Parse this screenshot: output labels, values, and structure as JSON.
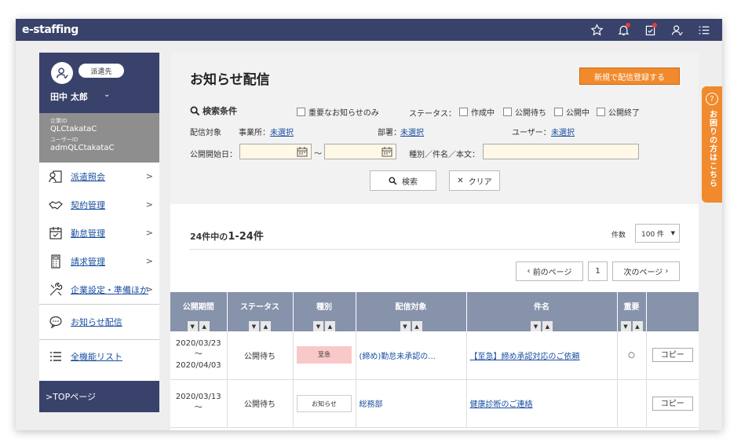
{
  "app": {
    "logo": "e-staffing"
  },
  "topbar": {
    "icons": [
      "star-icon",
      "bell-icon",
      "task-icon",
      "user-switch-icon",
      "menu-icon"
    ]
  },
  "user": {
    "tag": "派遣先",
    "name": "田中 太郎",
    "company_id_label": "企業ID",
    "company_id": "QLCtakataC",
    "user_id_label": "ユーザーID",
    "user_id": "admQLCtakataC"
  },
  "sidebar": {
    "items": [
      {
        "label": "派遣照会",
        "icon": "person-card-icon"
      },
      {
        "label": "契約管理",
        "icon": "handshake-icon"
      },
      {
        "label": "勤怠管理",
        "icon": "calendar-check-icon"
      },
      {
        "label": "請求管理",
        "icon": "calculator-icon"
      },
      {
        "label": "企業設定・準備ほか",
        "icon": "tools-icon"
      }
    ],
    "notice": "お知らせ配信",
    "all_functions": "全機能リスト",
    "top_page": ">TOPページ"
  },
  "main": {
    "title": "お知らせ配信",
    "new_button": "新規で配信登録する",
    "search": {
      "title": "検索条件",
      "important_only": "重要なお知らせのみ",
      "status_label": "ステータス：",
      "status_options": [
        "作成中",
        "公開待ち",
        "公開中",
        "公開終了"
      ],
      "target_label": "配信対象",
      "office_label": "事業所：",
      "office_value": "未選択",
      "dept_label": "部署：",
      "dept_value": "未選択",
      "user_label": "ユーザー：",
      "user_value": "未選択",
      "date_label": "公開開始日：",
      "tilde": "～",
      "keyword_label": "種別／件名／本文：",
      "search_button": "検索",
      "clear_button": "クリア"
    },
    "results": {
      "count_prefix": "24件中の",
      "count_range": "1-24件",
      "per_page_label": "件数",
      "per_page_value": "100 件",
      "prev": "前のページ",
      "page": "1",
      "next": "次のページ"
    },
    "table": {
      "headers": [
        "公開期間",
        "ステータス",
        "種別",
        "配信対象",
        "件名",
        "重要",
        ""
      ],
      "rows": [
        {
          "start": "2020/03/23",
          "tilde": "～",
          "end": "2020/04/03",
          "status": "公開待ち",
          "type": "至急",
          "target": "(締め)勤怠未承認の...",
          "subject": "【至急】締め承認対応のご依頼",
          "important": "○",
          "action": "コピー"
        },
        {
          "start": "2020/03/13",
          "tilde": "～",
          "end": "",
          "status": "公開待ち",
          "type": "お知らせ",
          "target": "総務部",
          "subject": "健康診断のご連絡",
          "important": "",
          "action": "コピー"
        }
      ]
    }
  },
  "help_tab": {
    "label": "お困りの方はこちら",
    "icon": "question-icon"
  },
  "colors": {
    "navy": "#39426b",
    "orange": "#f08a2c",
    "table_header": "#8792ab"
  }
}
